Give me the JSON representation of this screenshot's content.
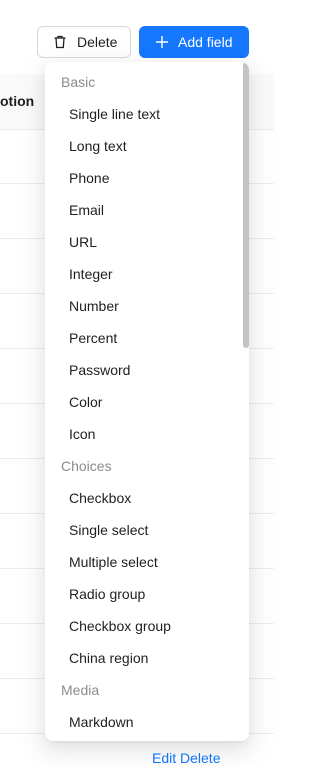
{
  "toolbar": {
    "delete_label": "Delete",
    "add_field_label": "Add field"
  },
  "table": {
    "partial_header": "otion",
    "partial_row_action": "Edit  Delete"
  },
  "field_menu": {
    "groups": [
      {
        "label": "Basic",
        "items": [
          "Single line text",
          "Long text",
          "Phone",
          "Email",
          "URL",
          "Integer",
          "Number",
          "Percent",
          "Password",
          "Color",
          "Icon"
        ]
      },
      {
        "label": "Choices",
        "items": [
          "Checkbox",
          "Single select",
          "Multiple select",
          "Radio group",
          "Checkbox group",
          "China region"
        ]
      },
      {
        "label": "Media",
        "items": [
          "Markdown"
        ]
      }
    ]
  },
  "icons": {
    "delete": "trash-icon",
    "add": "plus-icon"
  },
  "colors": {
    "primary": "#1677ff",
    "group_label": "#8c8c8c"
  }
}
